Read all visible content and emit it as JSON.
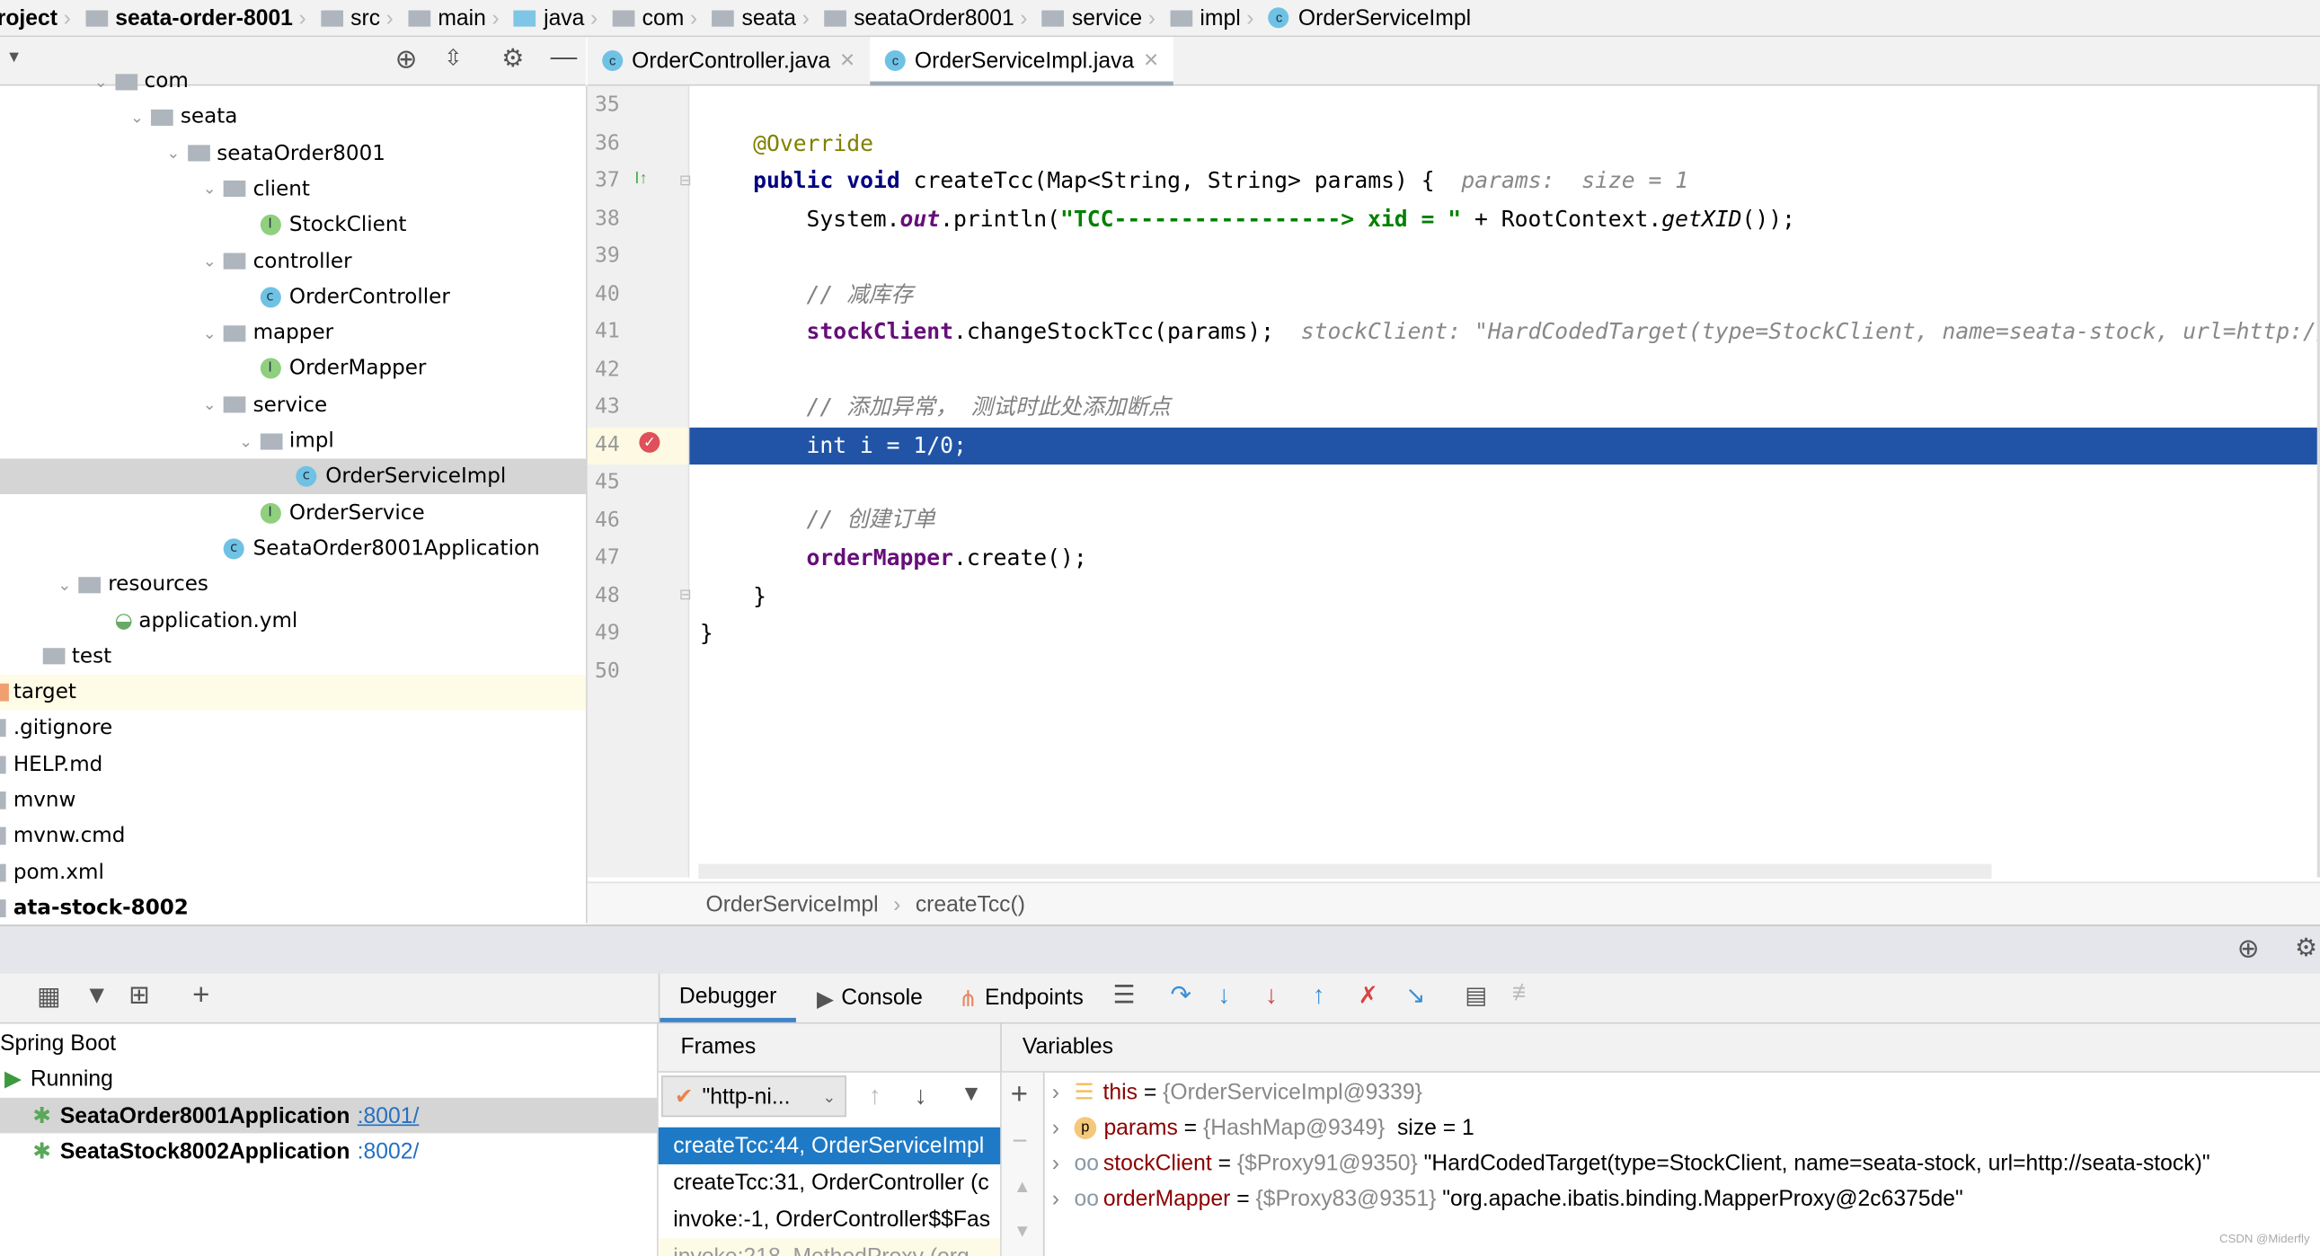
{
  "breadcrumb": [
    "roject",
    "seata-order-8001",
    "src",
    "main",
    "java",
    "com",
    "seata",
    "seataOrder8001",
    "service",
    "impl",
    "OrderServiceImpl"
  ],
  "tree": [
    {
      "label": "com",
      "indent": 3,
      "type": "folder",
      "exp": true
    },
    {
      "label": "seata",
      "indent": 4,
      "type": "folder",
      "exp": true
    },
    {
      "label": "seataOrder8001",
      "indent": 5,
      "type": "folder",
      "exp": true
    },
    {
      "label": "client",
      "indent": 6,
      "type": "folder",
      "exp": true
    },
    {
      "label": "StockClient",
      "indent": 7,
      "type": "interface"
    },
    {
      "label": "controller",
      "indent": 6,
      "type": "folder",
      "exp": true
    },
    {
      "label": "OrderController",
      "indent": 7,
      "type": "class"
    },
    {
      "label": "mapper",
      "indent": 6,
      "type": "folder",
      "exp": true
    },
    {
      "label": "OrderMapper",
      "indent": 7,
      "type": "interface"
    },
    {
      "label": "service",
      "indent": 6,
      "type": "folder",
      "exp": true
    },
    {
      "label": "impl",
      "indent": 7,
      "type": "folder",
      "exp": true
    },
    {
      "label": "OrderServiceImpl",
      "indent": 8,
      "type": "class",
      "selected": true
    },
    {
      "label": "OrderService",
      "indent": 7,
      "type": "interface"
    },
    {
      "label": "SeataOrder8001Application",
      "indent": 6,
      "type": "springclass"
    },
    {
      "label": "resources",
      "indent": 2,
      "type": "resfolder",
      "exp": true
    },
    {
      "label": "application.yml",
      "indent": 3,
      "type": "yml"
    },
    {
      "label": "test",
      "indent": 1,
      "type": "folder"
    },
    {
      "label": "target",
      "indent": 0,
      "type": "target",
      "highlight": true
    },
    {
      "label": ".gitignore",
      "indent": 0,
      "type": "file"
    },
    {
      "label": "HELP.md",
      "indent": 0,
      "type": "file"
    },
    {
      "label": "mvnw",
      "indent": 0,
      "type": "file"
    },
    {
      "label": "mvnw.cmd",
      "indent": 0,
      "type": "file"
    },
    {
      "label": "pom.xml",
      "indent": 0,
      "type": "file"
    },
    {
      "label": "ata-stock-8002",
      "indent": 0,
      "type": "module",
      "bold": true
    }
  ],
  "editor": {
    "tabs": [
      {
        "label": "OrderController.java",
        "active": false
      },
      {
        "label": "OrderServiceImpl.java",
        "active": true
      }
    ],
    "line_numbers": [
      "35",
      "36",
      "37",
      "38",
      "39",
      "40",
      "41",
      "42",
      "43",
      "44",
      "45",
      "46",
      "47",
      "48",
      "49",
      "50"
    ],
    "lines": {
      "l36": "@Override",
      "l37a": "public void ",
      "l37b": "createTcc(Map<String, String> params) {  ",
      "l37hint": "params:  size = 1",
      "l38a": "System.",
      "l38b": "out",
      "l38c": ".println(",
      "l38d": "\"TCC-----------------> xid = \"",
      "l38e": " + RootContext.",
      "l38f": "getXID",
      "l38g": "());",
      "l40": "// 减库存",
      "l41a": "stockClient",
      "l41b": ".changeStockTcc(params);  ",
      "l41hint": "stockClient: \"HardCodedTarget(type=StockClient, name=seata-stock, url=http://seata-stock)\"",
      "l43": "// 添加异常， 测试时此处添加断点",
      "l44": "int i = 1/0;",
      "l46": "// 创建订单",
      "l47a": "orderMapper",
      "l47b": ".create();",
      "l48": "}",
      "l49": "}"
    },
    "current_line": "44",
    "breadcrumb": [
      "OrderServiceImpl",
      "createTcc()"
    ]
  },
  "services": {
    "root": "Spring Boot",
    "status": "Running",
    "apps": [
      {
        "name": "SeataOrder8001Application",
        "port": ":8001/",
        "selected": true
      },
      {
        "name": "SeataStock8002Application",
        "port": ":8002/"
      }
    ]
  },
  "debugger": {
    "tabs": [
      "Debugger",
      "Console",
      "Endpoints"
    ],
    "frames_label": "Frames",
    "variables_label": "Variables",
    "thread": "\"http-ni...",
    "frames": [
      "createTcc:44, OrderServiceImpl",
      "createTcc:31, OrderController (c",
      "invoke:-1, OrderController$$Fas",
      "invoke:218, MethodProxy (org"
    ],
    "variables": [
      {
        "name": "this",
        "eq": " = ",
        "type": "{OrderServiceImpl@9339}",
        "value": "",
        "icon": "field"
      },
      {
        "name": "params",
        "eq": " = ",
        "type": "{HashMap@9349}",
        "value": "  size = 1",
        "icon": "param"
      },
      {
        "name": "stockClient",
        "eq": " = ",
        "type": "{$Proxy91@9350}",
        "value": " \"HardCodedTarget(type=StockClient, name=seata-stock, url=http://seata-stock)\"",
        "icon": "watch"
      },
      {
        "name": "orderMapper",
        "eq": " = ",
        "type": "{$Proxy83@9351}",
        "value": " \"org.apache.ibatis.binding.MapperProxy@2c6375de\"",
        "icon": "watch"
      }
    ]
  },
  "watermark": "CSDN @Miderfly",
  "colors": {
    "highlight": "#2154a6",
    "frame_selected": "#1e7ac6",
    "keyword": "#000080",
    "string": "#008000",
    "field": "#660e7a"
  }
}
